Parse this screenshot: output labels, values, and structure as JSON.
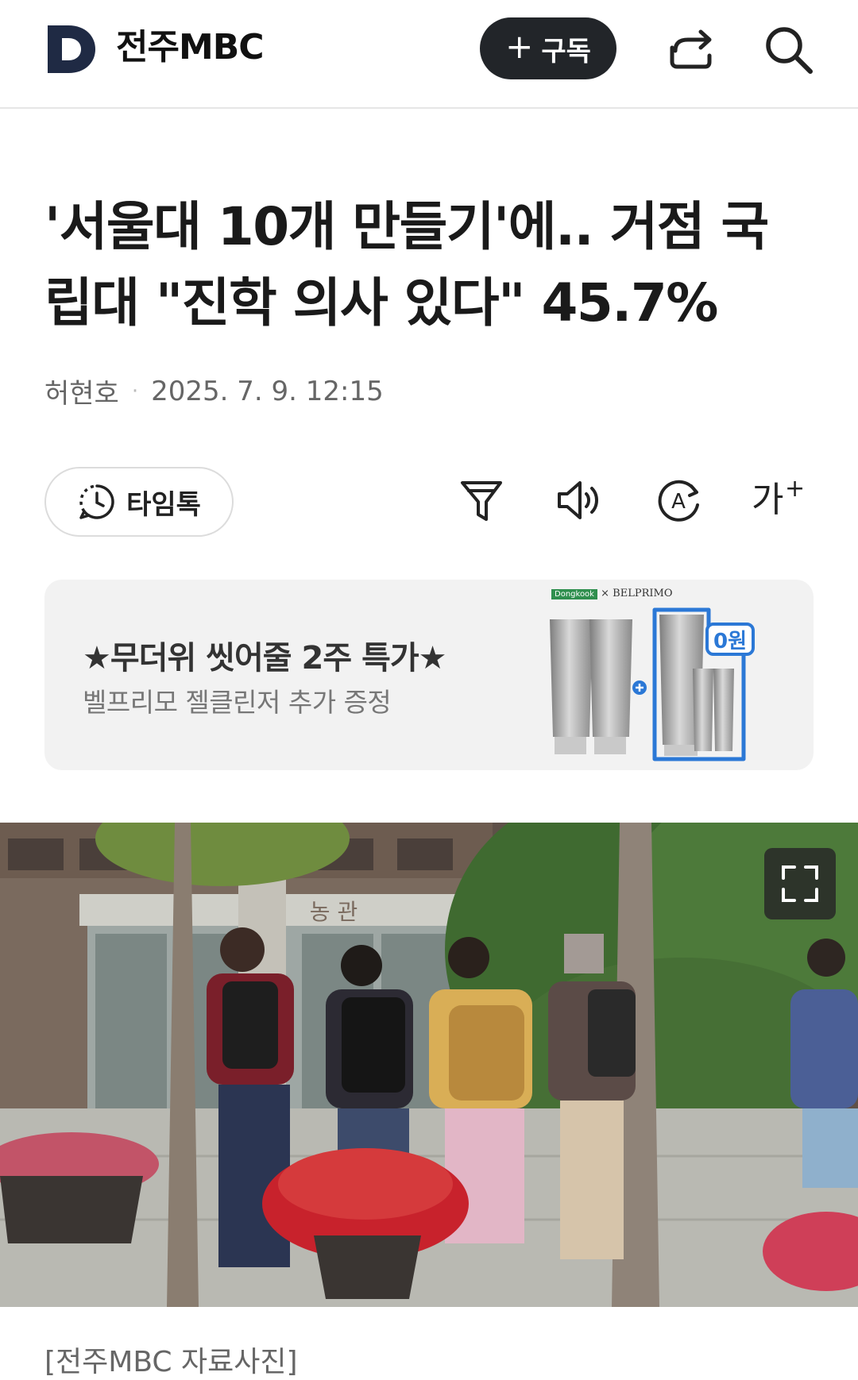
{
  "header": {
    "brand": "전주MBC",
    "subscribe_label": "구독",
    "subscribe_plus": "+"
  },
  "article": {
    "headline_line1": "'서울대 10개 만들기'에.. 거점 국",
    "headline_line2": "립대 \"진학 의사 있다\" 45.7%",
    "author": "허현호",
    "separator": "·",
    "datetime": "2025. 7. 9. 12:15"
  },
  "toolbar": {
    "timetalk_label": "타임톡",
    "font_size_label": "가",
    "font_size_plus": "+"
  },
  "ad": {
    "title": "★무더위 씻어줄 2주 특가★",
    "subtitle": "벨프리모 젤클린저 추가 증정",
    "brand_left": "Dongkook",
    "brand_x": "×",
    "brand_right": "BELPRIMO",
    "free_badge": "0원"
  },
  "photo": {
    "sign_text": "농 관",
    "caption": "[전주MBC 자료사진]"
  },
  "colors": {
    "dark_button": "#222529",
    "ad_background": "#f2f2f2",
    "ad_blue": "#2b78d6"
  }
}
